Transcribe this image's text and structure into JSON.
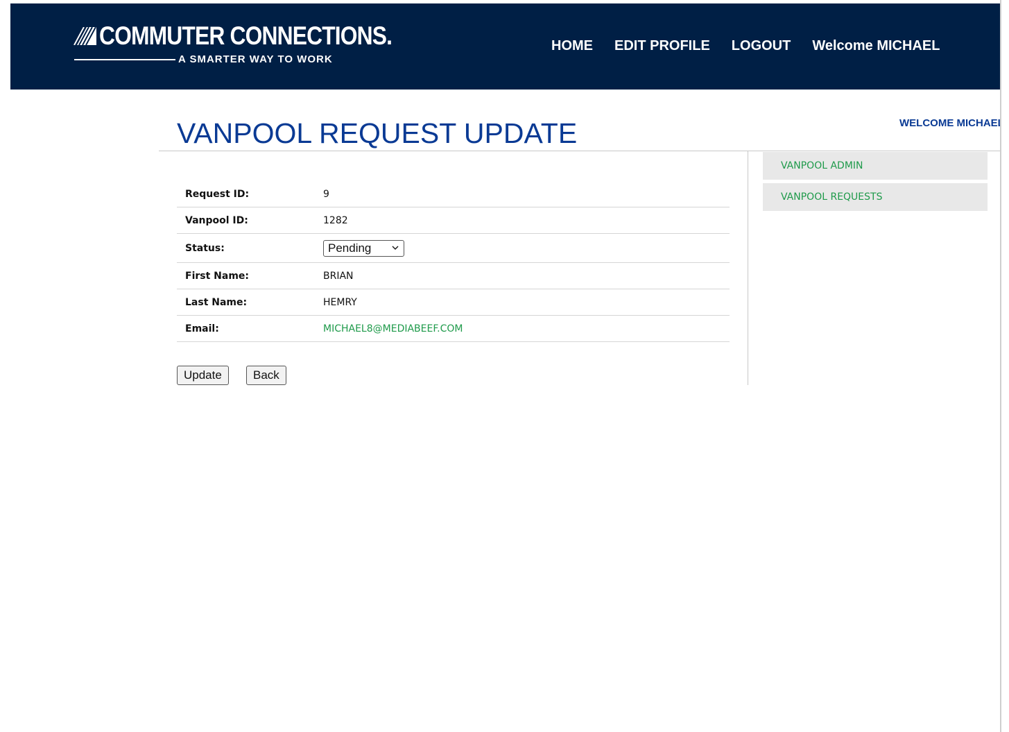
{
  "header": {
    "logo_title": "COMMUTER CONNECTIONS.",
    "logo_tagline": "A SMARTER WAY TO WORK",
    "nav": [
      {
        "label": "HOME"
      },
      {
        "label": "EDIT PROFILE"
      },
      {
        "label": "LOGOUT"
      },
      {
        "label": "Welcome MICHAEL"
      }
    ]
  },
  "page": {
    "title": "VANPOOL REQUEST UPDATE",
    "welcome": "WELCOME MICHAEL"
  },
  "sidebar": {
    "items": [
      {
        "label": "VANPOOL ADMIN"
      },
      {
        "label": "VANPOOL REQUESTS"
      }
    ]
  },
  "form": {
    "rows": [
      {
        "label": "Request ID:",
        "value": "9"
      },
      {
        "label": "Vanpool ID:",
        "value": "1282"
      },
      {
        "label": "Status:",
        "value": "Pending"
      },
      {
        "label": "First Name:",
        "value": "BRIAN"
      },
      {
        "label": "Last Name:",
        "value": "HEMRY"
      },
      {
        "label": "Email:",
        "value": "MICHAEL8@MEDIABEEF.COM"
      }
    ],
    "update_label": "Update",
    "back_label": "Back"
  },
  "colors": {
    "header_bg": "#001f45",
    "title_blue": "#0a3a94",
    "link_green": "#1e9a4a",
    "sidebar_bg": "#e8e8e8"
  }
}
